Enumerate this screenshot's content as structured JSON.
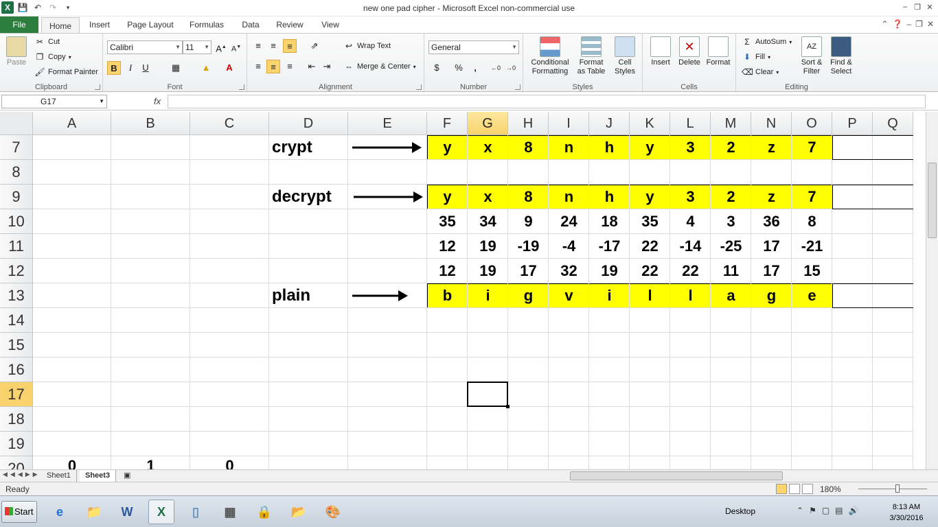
{
  "window": {
    "title": "new one pad cipher  -  Microsoft Excel non-commercial use",
    "app_icon": "X"
  },
  "ribbon_tabs": [
    "File",
    "Home",
    "Insert",
    "Page Layout",
    "Formulas",
    "Data",
    "Review",
    "View"
  ],
  "active_tab": "Home",
  "ribbon": {
    "clipboard": {
      "paste": "Paste",
      "cut": "Cut",
      "copy": "Copy",
      "format_painter": "Format Painter",
      "label": "Clipboard"
    },
    "font": {
      "name": "Calibri",
      "size": "11",
      "label": "Font",
      "bold": "B",
      "italic": "I",
      "underline": "U"
    },
    "alignment": {
      "wrap_text": "Wrap Text",
      "merge_center": "Merge & Center",
      "label": "Alignment"
    },
    "number": {
      "format": "General",
      "currency": "$",
      "percent": "%",
      "comma": ",",
      "label": "Number"
    },
    "styles": {
      "conditional": "Conditional",
      "conditional2": "Formatting",
      "format_table": "Format",
      "format_table2": "as Table",
      "cell_styles": "Cell",
      "cell_styles2": "Styles",
      "label": "Styles"
    },
    "cells": {
      "insert": "Insert",
      "delete": "Delete",
      "format": "Format",
      "label": "Cells"
    },
    "editing": {
      "autosum": "AutoSum",
      "fill": "Fill",
      "clear": "Clear",
      "sort": "Sort &",
      "sort2": "Filter",
      "find": "Find &",
      "find2": "Select",
      "label": "Editing"
    }
  },
  "formula_bar": {
    "name_box": "G17",
    "fx": "fx",
    "content": ""
  },
  "columns": [
    "A",
    "B",
    "C",
    "D",
    "E",
    "F",
    "G",
    "H",
    "I",
    "J",
    "K",
    "L",
    "M",
    "N",
    "O",
    "P",
    "Q"
  ],
  "selected_column": "G",
  "rows": [
    "7",
    "8",
    "9",
    "10",
    "11",
    "12",
    "13",
    "14",
    "15",
    "16",
    "17",
    "18",
    "19",
    "20"
  ],
  "selected_row": "17",
  "labels": {
    "row7": "crypt",
    "row9": "decrypt",
    "row13": "plain"
  },
  "sheet": {
    "row7": [
      "y",
      "x",
      "8",
      "n",
      "h",
      "y",
      "3",
      "2",
      "z",
      "7"
    ],
    "row9": [
      "y",
      "x",
      "8",
      "n",
      "h",
      "y",
      "3",
      "2",
      "z",
      "7"
    ],
    "row10": [
      "35",
      "34",
      "9",
      "24",
      "18",
      "35",
      "4",
      "3",
      "36",
      "8"
    ],
    "row11": [
      "12",
      "19",
      "-19",
      "-4",
      "-17",
      "22",
      "-14",
      "-25",
      "17",
      "-21"
    ],
    "row12": [
      "12",
      "19",
      "17",
      "32",
      "19",
      "22",
      "22",
      "11",
      "17",
      "15"
    ],
    "row13": [
      "b",
      "i",
      "g",
      "v",
      "i",
      "l",
      "l",
      "a",
      "g",
      "e"
    ],
    "row20": [
      "0",
      "1",
      "0"
    ]
  },
  "sheet_tabs": [
    "Sheet1",
    "Sheet3"
  ],
  "active_sheet": "Sheet3",
  "status": {
    "text": "Ready",
    "zoom": "180%"
  },
  "taskbar": {
    "start": "Start",
    "desktop": "Desktop",
    "time": "8:13 AM",
    "date": "3/30/2016"
  },
  "colors": {
    "highlight": "#ffff00",
    "file_tab": "#2c7d3d",
    "selection_header": "#f8d26c"
  }
}
